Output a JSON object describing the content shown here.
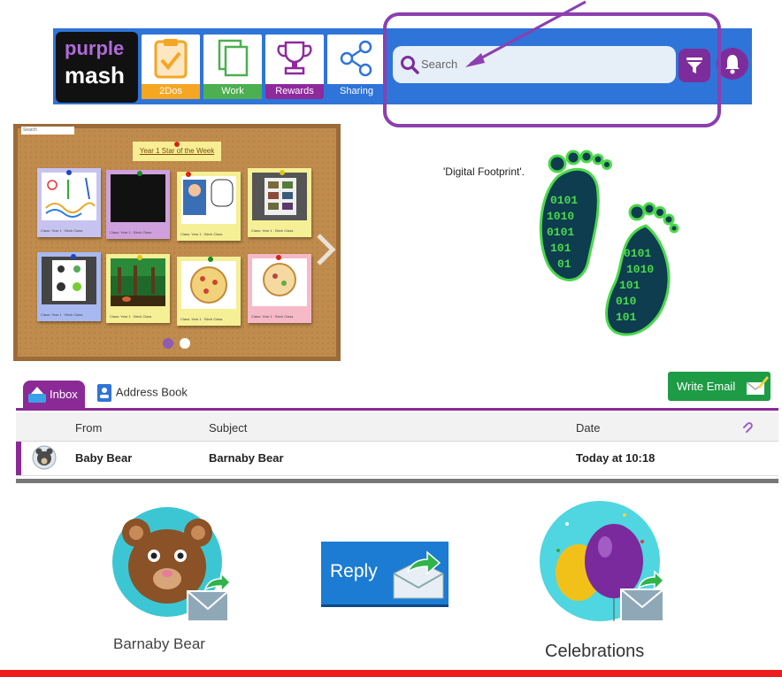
{
  "logo": {
    "line1": "purple",
    "line2": "mash"
  },
  "nav_tiles": [
    {
      "label": "2Dos",
      "color": "#f5a623"
    },
    {
      "label": "Work",
      "color": "#4caf50"
    },
    {
      "label": "Rewards",
      "color": "#8e2a9c"
    },
    {
      "label": "Sharing",
      "color": "#2f74d8"
    }
  ],
  "search": {
    "placeholder": "Search"
  },
  "corkboard": {
    "search_label": "Search",
    "title": "Year 1 Star of the Week",
    "card_caption": "Class: Year 1 · Birch Class"
  },
  "footprint": {
    "label": "'Digital Footprint'."
  },
  "email": {
    "tabs": {
      "inbox": "Inbox",
      "address_book": "Address Book"
    },
    "write_button": "Write Email",
    "columns": {
      "from": "From",
      "subject": "Subject",
      "date": "Date"
    },
    "rows": [
      {
        "from": "Baby Bear",
        "subject": "Barnaby Bear",
        "date": "Today at 10:18"
      }
    ]
  },
  "bottom": {
    "contact_caption": "Barnaby Bear",
    "reply_label": "Reply",
    "celebrations_caption": "Celebrations"
  },
  "colors": {
    "brand_purple": "#8b2a96",
    "bar_blue": "#2f74d8",
    "write_green": "#1e9b45",
    "reply_blue": "#1c7bd3",
    "footer_red": "#ee1c1c"
  }
}
